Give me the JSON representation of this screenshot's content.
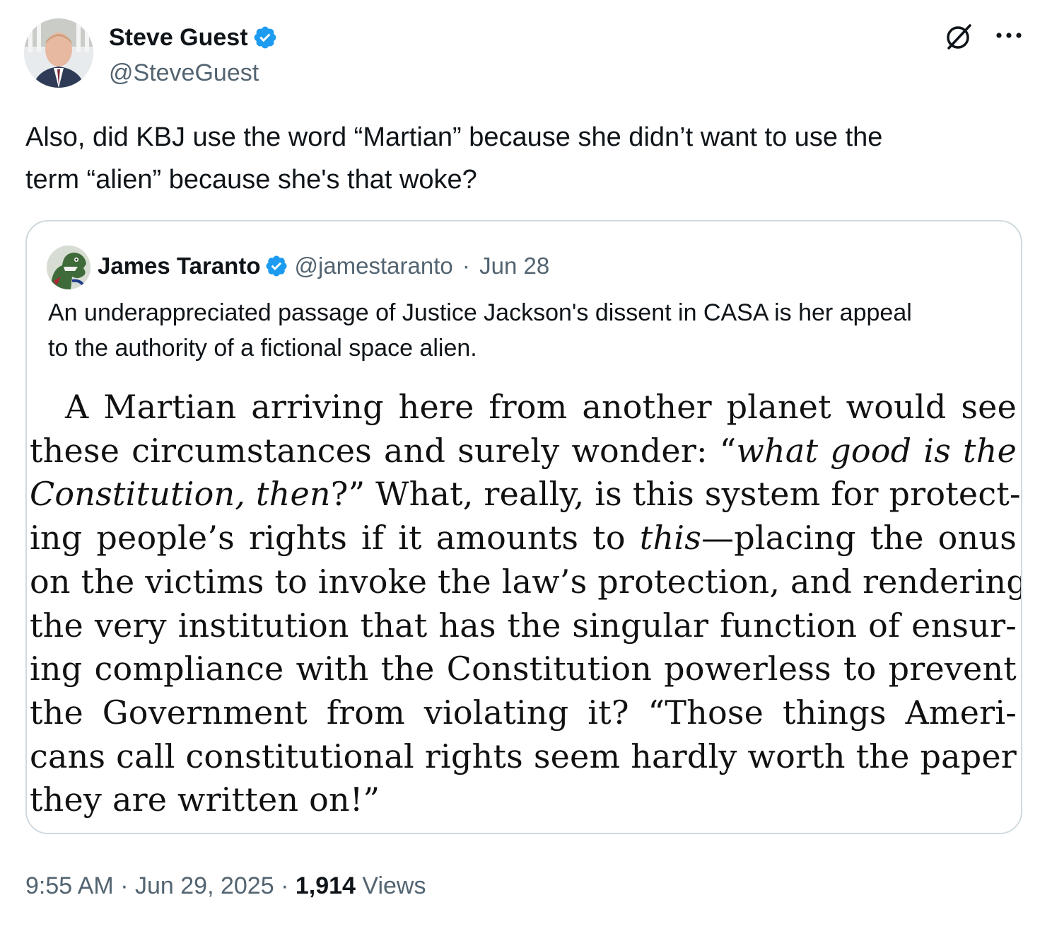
{
  "author": {
    "name": "Steve Guest",
    "handle": "@SteveGuest",
    "verified": true
  },
  "tweet": {
    "text_line1": "Also, did KBJ use the word “Martian” because she didn’t want to use the",
    "text_line2": "term “alien” because she's that woke?"
  },
  "quote": {
    "name": "James Taranto",
    "handle": "@jamestaranto",
    "sep": "·",
    "date": "Jun 28",
    "text_line1": "An underappreciated passage of Justice Jackson's dissent in CASA is her appeal",
    "text_line2": "to the authority of a fictional space alien.",
    "image_passage": {
      "l1": "A Martian arriving here from another planet would see",
      "l2a": "these circumstances and surely wonder: “",
      "l2b": "what good is the",
      "l3a": "Constitution, then",
      "l3b": "?” What, really, is this system for protect-",
      "l4a": "ing people’s rights if it amounts to ",
      "l4b": "this",
      "l4c": "—placing the onus",
      "l5": "on the victims to invoke the law’s protection, and rendering",
      "l6": "the very institution that has the singular function of ensur-",
      "l7": "ing compliance with the Constitution powerless to prevent",
      "l8": "the Government from violating it?  “Those things Ameri-",
      "l9": "cans call constitutional rights seem hardly worth the paper",
      "l10": "they are written on!”"
    }
  },
  "footer": {
    "time": "9:55 AM",
    "sep1": "·",
    "date": "Jun 29, 2025",
    "sep2": "·",
    "views_count": "1,914",
    "views_label": "Views"
  },
  "icons": {
    "verified": "verified-badge-icon",
    "grok": "grok-icon",
    "more": "more-horizontal-icon"
  },
  "colors": {
    "verified_blue": "#1d9bf0",
    "secondary_text": "#536471",
    "primary_text": "#0f1419",
    "card_border": "#cfd9de"
  }
}
